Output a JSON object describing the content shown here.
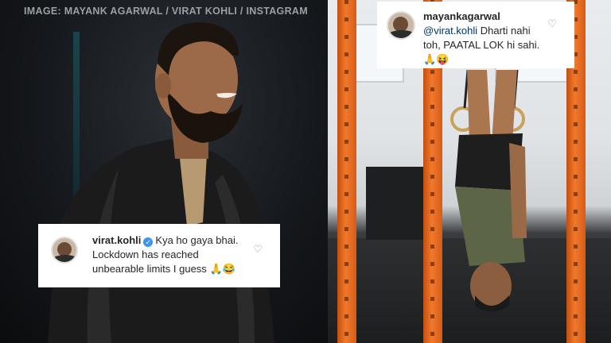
{
  "credit_line": "IMAGE: MAYANK AGARWAL / VIRAT KOHLI / INSTAGRAM",
  "left_comment": {
    "username": "virat.kohli",
    "verified": true,
    "text_line1": "Kya ho gaya bhai.",
    "text_line2": "Lockdown has reached",
    "text_line3": "unbearable limits I guess",
    "emojis": "🙏😂"
  },
  "right_comment": {
    "username": "mayankagarwal",
    "mention": "@virat.kohli",
    "text_part1": " Dharti nahi",
    "text_line2": "toh, PAATAL LOK hi sahi.",
    "emojis": "🙏😝"
  },
  "colors": {
    "pole_orange": "#f2782a",
    "verified_blue": "#3897f0",
    "mention_blue": "#003569"
  },
  "icons": [
    "heart-icon",
    "verified-badge-icon",
    "avatar"
  ]
}
